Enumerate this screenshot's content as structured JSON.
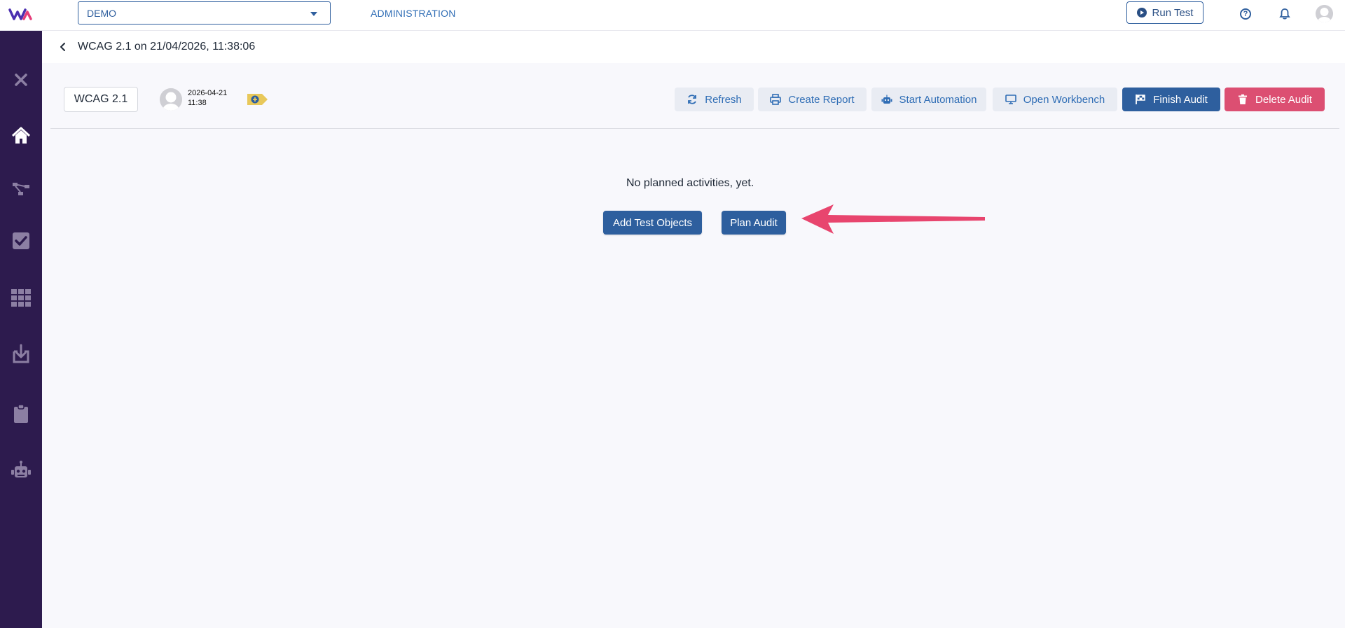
{
  "header": {
    "project_select": "DEMO",
    "admin_link": "ADMINISTRATION",
    "run_test_label": "Run Test",
    "help_glyph": "?"
  },
  "sidebar": {
    "items": [
      {
        "icon": "close-icon"
      },
      {
        "icon": "home-icon",
        "active": true
      },
      {
        "icon": "sitemap-icon"
      },
      {
        "icon": "checkbox-icon"
      },
      {
        "icon": "grid-icon"
      },
      {
        "icon": "download-icon"
      },
      {
        "icon": "clipboard-icon"
      },
      {
        "icon": "robot-icon"
      }
    ]
  },
  "page": {
    "title": "WCAG 2.1 on 21/04/2026, 11:38:06",
    "audit_tag": "WCAG 2.1",
    "date_line1": "2026-04-21",
    "date_line2": "11:38"
  },
  "toolbar": {
    "refresh": "Refresh",
    "create_report": "Create Report",
    "start_automation": "Start Automation",
    "open_workbench": "Open Workbench",
    "finish_audit": "Finish Audit",
    "delete_audit": "Delete Audit"
  },
  "empty_state": {
    "message": "No planned activities, yet.",
    "add_test_objects": "Add Test Objects",
    "plan_audit": "Plan Audit"
  },
  "colors": {
    "sidebar_bg": "#2d1b4e",
    "primary": "#2e5f9e",
    "danger": "#dc4f72",
    "arrow": "#e8456e",
    "label_yellow": "#e8c85a"
  }
}
